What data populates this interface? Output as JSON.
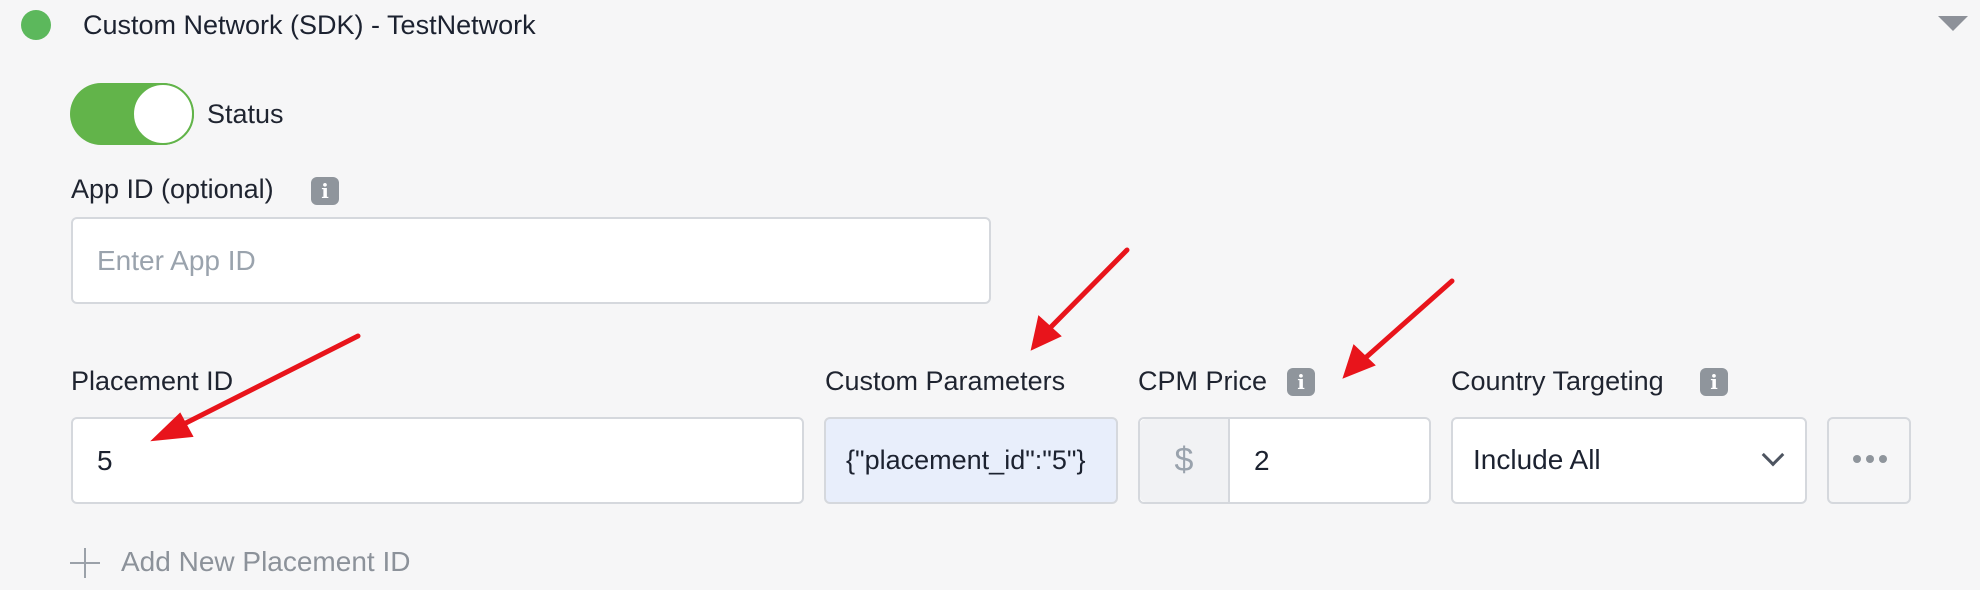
{
  "header": {
    "network_title": "Custom Network (SDK) - TestNetwork",
    "status_dot_color": "#5cb85c"
  },
  "status": {
    "label": "Status",
    "enabled": true,
    "toggle_color": "#62b44a"
  },
  "app_id": {
    "label": "App ID (optional)",
    "placeholder": "Enter App ID",
    "value": ""
  },
  "placement_id": {
    "label": "Placement ID",
    "value": "5"
  },
  "custom_parameters": {
    "label": "Custom Parameters",
    "value": "{\"placement_id\":\"5\"}",
    "background_color": "#e8eefb"
  },
  "cpm_price": {
    "label": "CPM Price",
    "currency_symbol": "$",
    "value": "2"
  },
  "country_targeting": {
    "label": "Country Targeting",
    "selected": "Include All"
  },
  "actions": {
    "add_placement_label": "Add New Placement ID",
    "more_icon": "more-horizontal-icon"
  },
  "annotations": {
    "arrow_color": "#e8141b",
    "arrow_count": 3
  }
}
